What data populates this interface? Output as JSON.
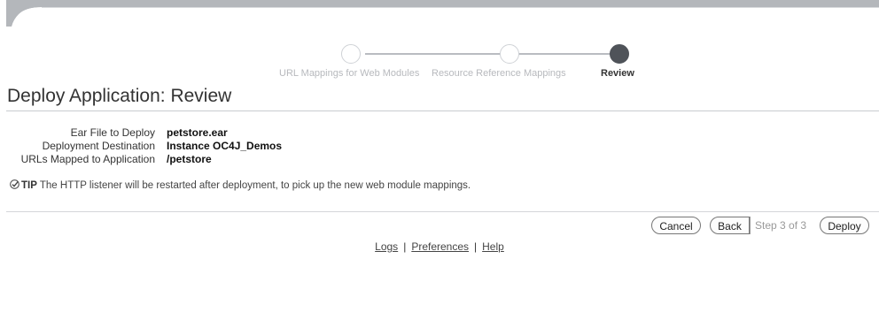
{
  "train": {
    "steps": [
      {
        "label": "URL Mappings for Web Modules",
        "state": "visited"
      },
      {
        "label": "Resource Reference Mappings",
        "state": "visited"
      },
      {
        "label": "Review",
        "state": "current"
      }
    ]
  },
  "page": {
    "title": "Deploy Application: Review"
  },
  "fields": [
    {
      "label": "Ear File to Deploy",
      "value": "petstore.ear"
    },
    {
      "label": "Deployment Destination",
      "value": "Instance OC4J_Demos"
    },
    {
      "label": "URLs Mapped to Application",
      "value": "/petstore"
    }
  ],
  "tip": {
    "icon": "checkmark-tip-icon",
    "label": "TIP",
    "text": "The HTTP listener will be restarted after deployment, to pick up the new web module mappings."
  },
  "actions": {
    "cancel": "Cancel",
    "back": "Back",
    "step_text": "Step 3 of 3",
    "deploy": "Deploy"
  },
  "footer": {
    "links": [
      "Logs",
      "Preferences",
      "Help"
    ]
  }
}
